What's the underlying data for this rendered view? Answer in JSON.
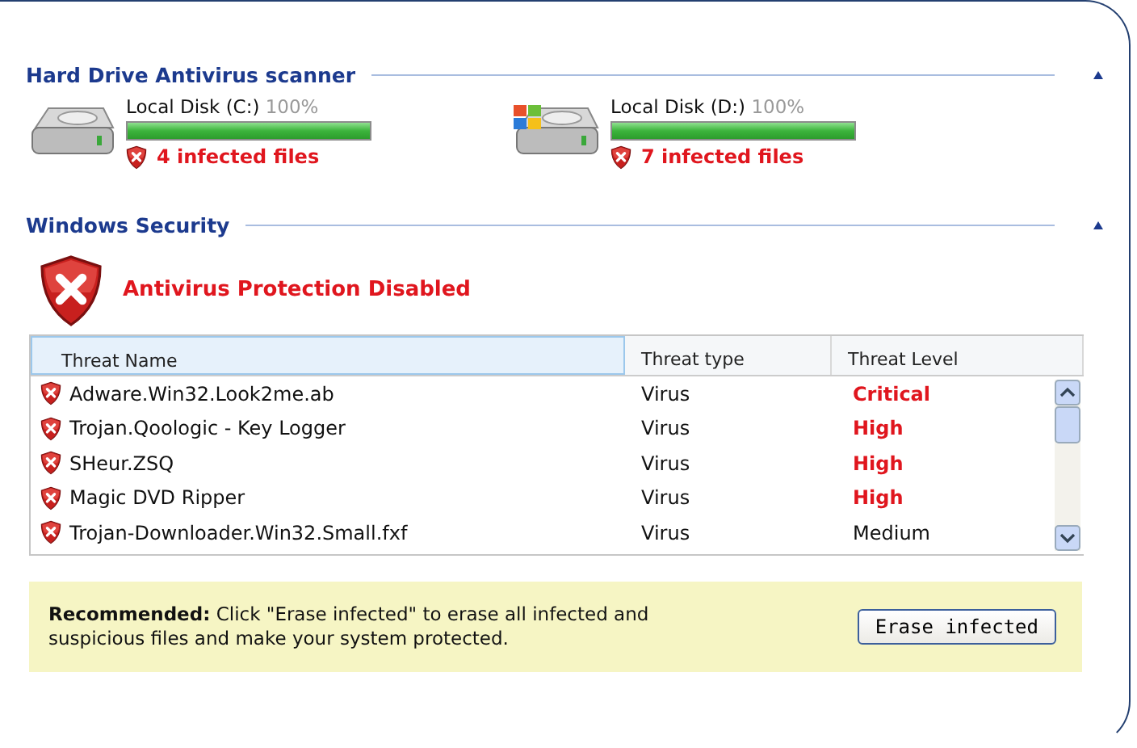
{
  "scanner": {
    "title": "Hard Drive Antivirus scanner",
    "disks": [
      {
        "label": "Local Disk (C:)",
        "percent": "100%",
        "level": 1,
        "infected": "4 infected files",
        "kind": "plain"
      },
      {
        "label": "Local Disk (D:)",
        "percent": "100%",
        "level": 1,
        "infected": "7 infected files",
        "kind": "system"
      }
    ]
  },
  "security": {
    "title": "Windows Security",
    "status": "Antivirus Protection Disabled",
    "table": {
      "columns": [
        "Threat Name",
        "Threat type",
        "Threat Level"
      ],
      "rows": [
        {
          "name": "Adware.Win32.Look2me.ab",
          "type": "Virus",
          "level": "Critical",
          "alert": true
        },
        {
          "name": "Trojan.Qoologic - Key Logger",
          "type": "Virus",
          "level": "High",
          "alert": true
        },
        {
          "name": "SHeur.ZSQ",
          "type": "Virus",
          "level": "High",
          "alert": true
        },
        {
          "name": "Magic DVD Ripper",
          "type": "Virus",
          "level": "High",
          "alert": true
        },
        {
          "name": "Trojan-Downloader.Win32.Small.fxf",
          "type": "Virus",
          "level": "Medium",
          "alert": false
        }
      ]
    }
  },
  "recommendation": {
    "text": "**Recommended:** Click \"Erase infected\" to erase all infected and suspicious files and make your system protected.",
    "button": "Erase infected"
  }
}
